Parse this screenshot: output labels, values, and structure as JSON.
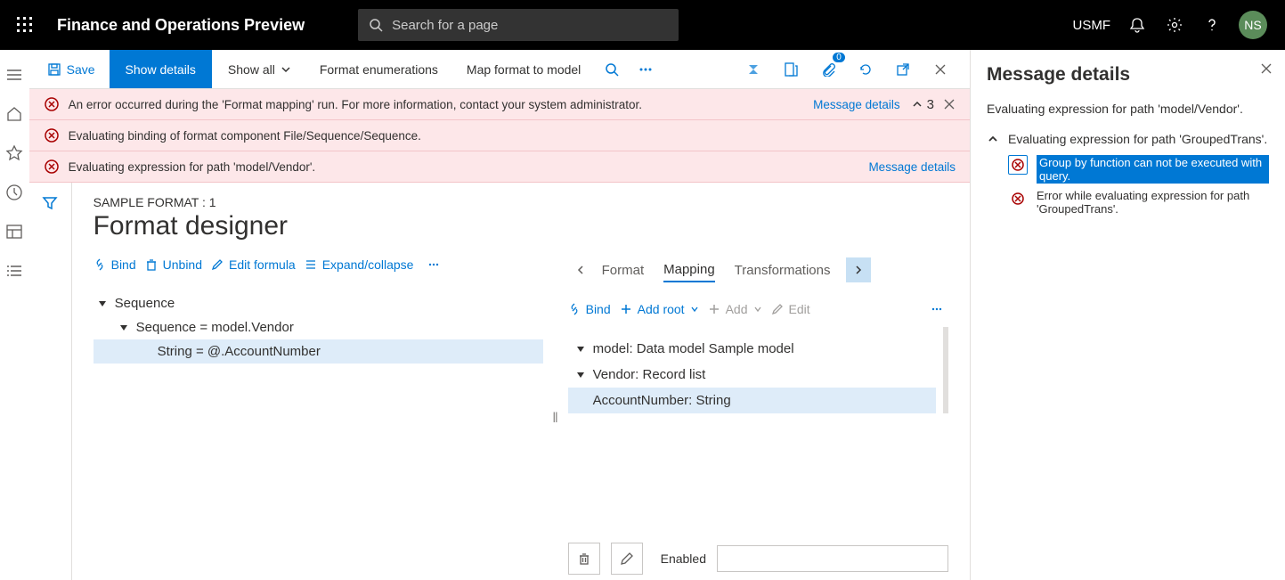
{
  "header": {
    "app_title": "Finance and Operations Preview",
    "search_placeholder": "Search for a page",
    "entity": "USMF",
    "avatar": "NS"
  },
  "action_bar": {
    "save": "Save",
    "show_details": "Show details",
    "show_all": "Show all",
    "format_enumerations": "Format enumerations",
    "map_format": "Map format to model",
    "attach_badge": "0"
  },
  "errors": {
    "e1": "An error occurred during the 'Format mapping' run. For more information, contact your system administrator.",
    "e2": "Evaluating binding of format component File/Sequence/Sequence.",
    "e3": "Evaluating expression for path 'model/Vendor'.",
    "msg_details": "Message details",
    "collapse_count": "3"
  },
  "designer": {
    "breadcrumb": "SAMPLE FORMAT : 1",
    "title": "Format designer",
    "left_tools": {
      "bind": "Bind",
      "unbind": "Unbind",
      "edit_formula": "Edit formula",
      "expand": "Expand/collapse"
    },
    "tabs": {
      "format": "Format",
      "mapping": "Mapping",
      "transformations": "Transformations"
    },
    "left_tree": {
      "n0": "Sequence",
      "n1": "Sequence = model.Vendor",
      "n2": "String = @.AccountNumber"
    },
    "right_tools": {
      "bind": "Bind",
      "add_root": "Add root",
      "add": "Add",
      "edit": "Edit"
    },
    "right_tree": {
      "n0": "model: Data model Sample model",
      "n1": "Vendor: Record list",
      "n2": "AccountNumber: String"
    },
    "enabled_label": "Enabled"
  },
  "panel": {
    "title": "Message details",
    "subtitle": "Evaluating expression for path 'model/Vendor'.",
    "expand_label": "Evaluating expression for path 'GroupedTrans'.",
    "err1": "Group by function can not be executed with query.",
    "err2": "Error while evaluating expression for path 'GroupedTrans'."
  }
}
